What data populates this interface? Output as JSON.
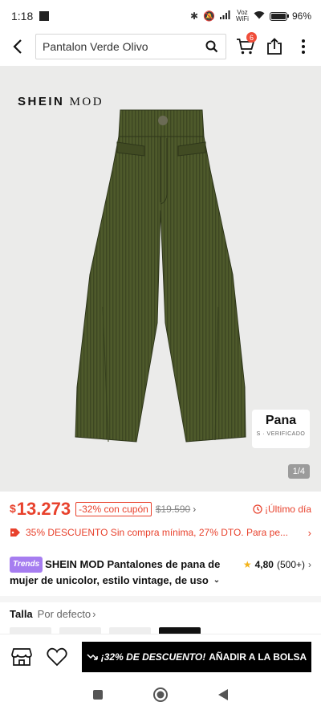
{
  "status": {
    "time": "1:18",
    "network_label_1": "Voz",
    "network_label_2": "WiFi",
    "battery": "96%"
  },
  "header": {
    "search_value": "Pantalon Verde Olivo",
    "cart_count": "6"
  },
  "hero": {
    "brand_mark_main": "SHEIN",
    "brand_mark_sub": "MOD",
    "material_label": "Pana",
    "material_sub": "S · VERIFICADO",
    "image_counter": "1/4",
    "garment_color": "#4e5a2b"
  },
  "price": {
    "currency": "$",
    "current": "13.273",
    "discount": "-32% con cupón",
    "original": "$19.590",
    "urgency": "¡Último día"
  },
  "promo": {
    "text": "35% DESCUENTO Sin compra mínima,  27% DTO. Para pe..."
  },
  "product": {
    "trend_badge": "Trends",
    "title_line1": "SHEIN MOD Pantalones de pana de",
    "title_line2": "mujer de unicolor, estilo vintage, de uso",
    "rating": "4,80",
    "reviews": "(500+)"
  },
  "size": {
    "label": "Talla",
    "sort_default": "Por defecto"
  },
  "actionbar": {
    "cta_percent": "¡32% DE DESCUENTO!",
    "cta_text": "AÑADIR A LA BOLSA"
  },
  "colors": {
    "accent": "#e8412c",
    "trend": "#a67df0",
    "cta_bg": "#000000"
  }
}
